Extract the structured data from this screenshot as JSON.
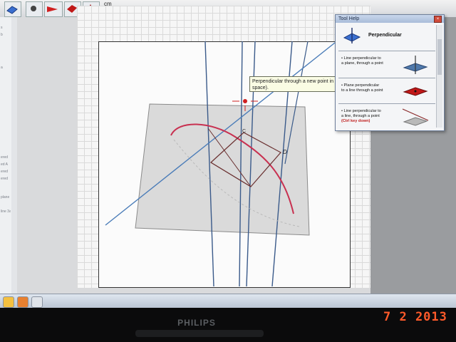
{
  "toolbar": {
    "unit_label": "cm",
    "buttons": [
      "plane-tool",
      "view-tool",
      "line-tool",
      "plane-tool-2",
      "prism-tool"
    ]
  },
  "tooltip": {
    "text": "Perpendicular through a new point in space)."
  },
  "tool_help": {
    "window_title": "Tool Help",
    "title": "Perpendicular",
    "items": [
      {
        "lines": [
          "• Line perpendicular to",
          "a plane, through a point"
        ],
        "icon": "line-plane-blue-icon"
      },
      {
        "lines": [
          "• Plane perpendicular",
          "to a line through a point"
        ],
        "icon": "plane-line-red-icon"
      },
      {
        "lines": [
          "• Line perpendicular to",
          "a line, through a point",
          "(Ctrl key down)"
        ],
        "icon": "line-line-gray-icon"
      }
    ],
    "ctrl_key": "Ctrl"
  },
  "scene": {
    "point_labels": [
      "D",
      "C"
    ]
  },
  "left_panel": {
    "items": [
      "s",
      "b",
      "a",
      "ered",
      "ed A",
      "ered",
      "ered",
      "plane",
      "line 3a"
    ]
  },
  "monitor": {
    "brand": "PHILIPS",
    "date_stamp": "7 2 2013"
  },
  "colors": {
    "blue_lines": "#3a5a8a",
    "red_curve": "#c83050",
    "plane_fill": "#cfcfcf",
    "highlight": "#c02020"
  }
}
